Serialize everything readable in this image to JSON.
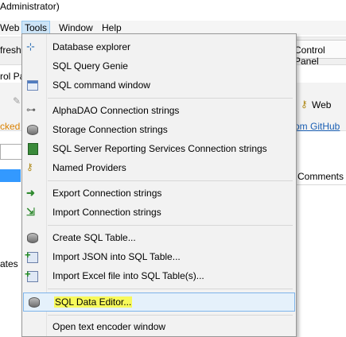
{
  "window": {
    "title_fragment": "Administrator)"
  },
  "menu_bar": {
    "items": [
      {
        "label": "Web"
      },
      {
        "label": "Tools"
      },
      {
        "label": "Window"
      },
      {
        "label": "Help"
      }
    ]
  },
  "background": {
    "refresh_fragment": "fresh",
    "control_panel_tab": "Control Panel",
    "panel_label_fragment": "rol Pa",
    "packed_fragment": "cked",
    "web_label": "Web",
    "github_link": "om GitHub",
    "comments_header": "Comments",
    "ates_fragment": "ates"
  },
  "tools_menu": {
    "items": [
      {
        "label": "Database explorer",
        "icon": "database-explorer-icon"
      },
      {
        "label": "SQL Query Genie",
        "icon": ""
      },
      {
        "label": "SQL command window",
        "icon": "window-icon"
      },
      {
        "label": "AlphaDAO Connection strings",
        "icon": "link-icon"
      },
      {
        "label": "Storage Connection strings",
        "icon": "storage-icon"
      },
      {
        "label": "SQL Server Reporting Services Connection strings",
        "icon": "report-icon"
      },
      {
        "label": "Named Providers",
        "icon": "key-icon"
      },
      {
        "label": "Export Connection strings",
        "icon": "export-icon"
      },
      {
        "label": "Import Connection strings",
        "icon": "import-icon"
      },
      {
        "label": "Create SQL Table...",
        "icon": "database-icon"
      },
      {
        "label": "Import JSON into SQL Table...",
        "icon": "import-table-icon"
      },
      {
        "label": "Import Excel file into SQL Table(s)...",
        "icon": "import-table-icon"
      },
      {
        "label": "SQL Data Editor...",
        "icon": "database-icon"
      },
      {
        "label": "Open text encoder window",
        "icon": ""
      }
    ]
  }
}
